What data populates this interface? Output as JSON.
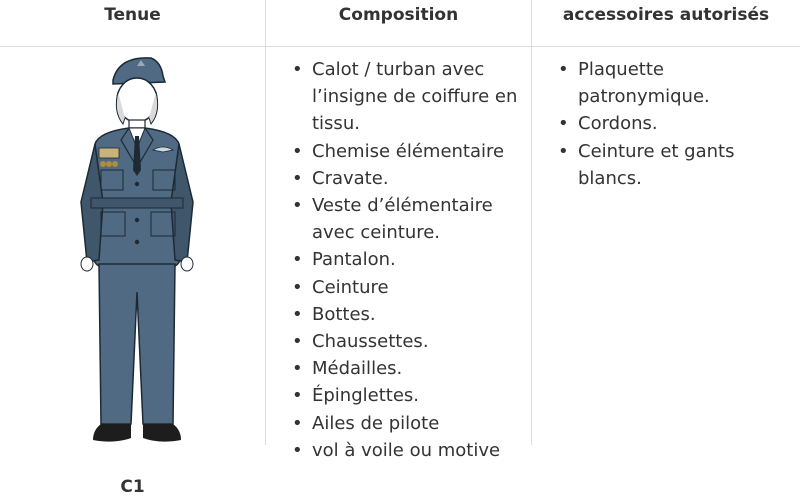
{
  "headers": {
    "col1": "Tenue",
    "col2": "Composition",
    "col3": "accessoires autorisés"
  },
  "uniform": {
    "code": "C1",
    "composition": [
      "Calot / turban avec l’insigne de coiffure en tissu.",
      "Chemise élémentaire",
      "Cravate.",
      "Veste d’élémentaire avec ceinture.",
      "Pantalon.",
      "Ceinture",
      "Bottes.",
      "Chaussettes.",
      "Médailles.",
      "Épinglettes.",
      "Ailes de pilote",
      "vol à voile ou motive"
    ],
    "accessories": [
      "Plaquette patronymique.",
      "Cordons.",
      "Ceinture et gants blancs."
    ]
  },
  "colors": {
    "uniform": "#4f6a82",
    "uniform_shade": "#3f566b",
    "skin": "#ffffff",
    "border": "#dcdcdc",
    "text": "#333333"
  },
  "icons": [
    "uniform-figure-icon",
    "list-bullet-icon"
  ]
}
